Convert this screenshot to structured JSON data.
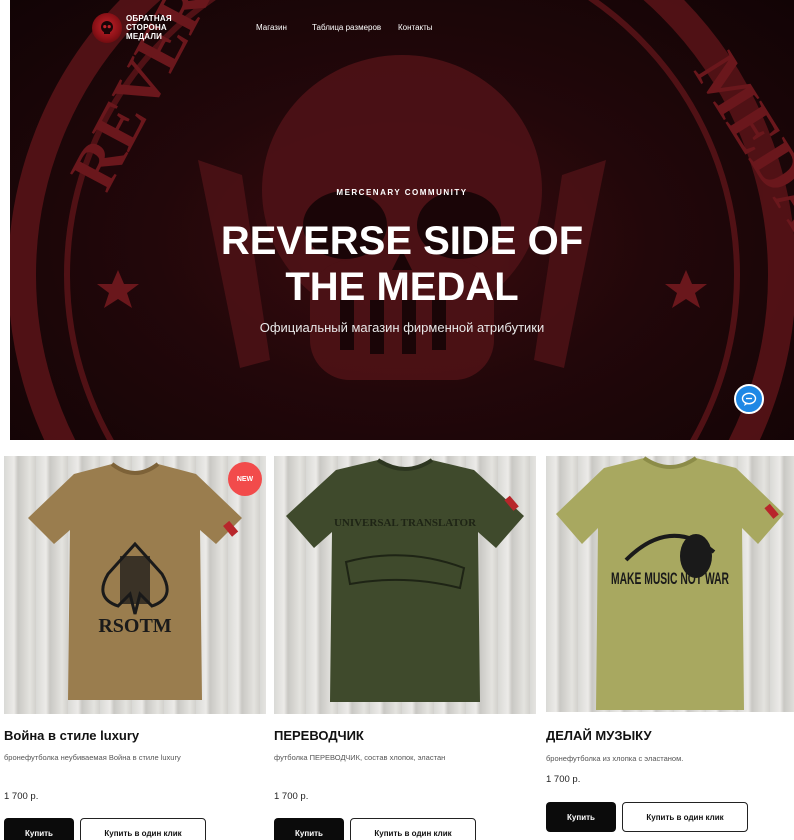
{
  "header": {
    "logo_lines": [
      "ОБРАТНАЯ",
      "СТОРОНА",
      "МЕДАЛИ"
    ],
    "nav": [
      "Магазин",
      "Таблица размеров",
      "Контакты"
    ]
  },
  "hero": {
    "kicker": "MERCENARY COMMUNITY",
    "title_lines": [
      "REVERSE SIDE OF",
      "THE MEDAL"
    ],
    "subtitle": "Официальный магазин фирменной атрибутики",
    "seal_text_left": "REVERSE",
    "seal_text_right": "MEDAL",
    "chat_icon": "chat-bubble-icon"
  },
  "products": [
    {
      "badge": "NEW",
      "shirt_print": "RSOTM",
      "shirt_color": "#9a7d4e",
      "title": "Война в стиле luxury",
      "description": "бронефутболка неубиваемая Война в стиле luxury",
      "price": "1 700 р.",
      "buy_label": "Купить",
      "quick_label": "Купить в один клик"
    },
    {
      "shirt_print": "UNIVERSAL TRANSLATOR",
      "shirt_color": "#3f4a2c",
      "title": "ПЕРЕВОДЧИК",
      "description": "футболка ПЕРЕВОДЧИК, состав хлопок, эластан",
      "price": "1 700 р.",
      "buy_label": "Купить",
      "quick_label": "Купить в один клик"
    },
    {
      "shirt_print": "MAKE MUSIC NOT WAR",
      "shirt_color": "#a8a860",
      "title": "ДЕЛАЙ МУЗЫКУ",
      "description": "бронефутболка из хлопка с эластаном.",
      "price": "1 700 р.",
      "buy_label": "Купить",
      "quick_label": "Купить в один клик"
    }
  ],
  "colors": {
    "accent_red": "#8c1117",
    "badge_red": "#f24b4b",
    "chat_blue": "#1e88e5",
    "button_dark": "#0b0b0b"
  }
}
